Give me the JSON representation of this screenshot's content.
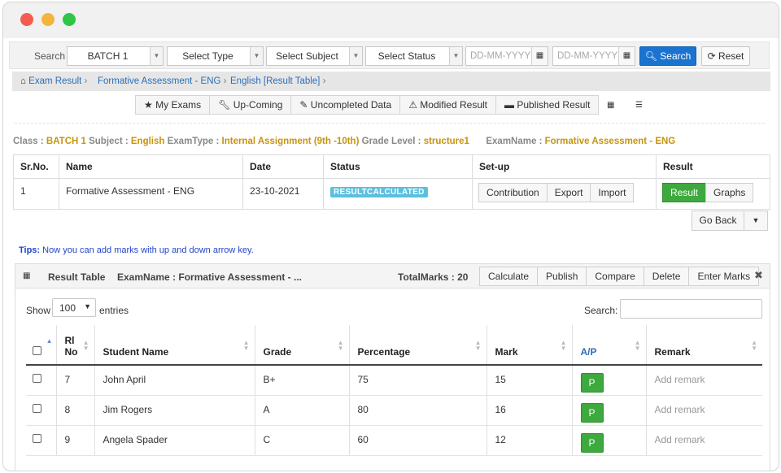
{
  "filter": {
    "search_label": "Search",
    "batch": "BATCH 1",
    "type": "Select Type",
    "subject": "Select Subject",
    "status": "Select Status",
    "date_from_placeholder": "DD-MM-YYYY",
    "date_to_placeholder": "DD-MM-YYYY",
    "search_btn": "Search",
    "reset_btn": "Reset"
  },
  "breadcrumb": [
    "Exam Result",
    "Formative Assessment - ENG",
    "English [Result Table]"
  ],
  "tabs": [
    "My Exams",
    "Up-Coming",
    "Uncompleted Data",
    "Modified Result",
    "Published Result"
  ],
  "info": {
    "class_label": "Class :",
    "class": "BATCH 1",
    "subject_label": "Subject :",
    "subject": "English",
    "examtype_label": "ExamType :",
    "examtype": "Internal Assignment (9th -10th)",
    "grade_label": "Grade Level :",
    "grade": "structure1",
    "examname_label": "ExamName :",
    "examname": "Formative Assessment - ENG"
  },
  "exam_table": {
    "headers": [
      "Sr.No.",
      "Name",
      "Date",
      "Status",
      "Set-up",
      "Result"
    ],
    "row": {
      "srno": "1",
      "name": "Formative Assessment - ENG",
      "date": "23-10-2021",
      "status": "RESULTCALCULATED",
      "setup_buttons": [
        "Contribution",
        "Export",
        "Import"
      ],
      "result_buttons": [
        "Result",
        "Graphs"
      ]
    }
  },
  "goback": "Go Back",
  "tips": {
    "label": "Tips:",
    "text": " Now you can add marks with up and down arrow key."
  },
  "result_panel": {
    "title": "Result Table",
    "examname": "ExamName : Formative Assessment - ...",
    "total": "TotalMarks : 20",
    "buttons": [
      "Calculate",
      "Publish",
      "Compare",
      "Delete",
      "Enter Marks"
    ],
    "close": "✖",
    "show_label": "Show",
    "show_value": "100",
    "entries_label": "entries",
    "search_label": "Search:",
    "columns": [
      "Rl No",
      "Student Name",
      "Grade",
      "Percentage",
      "Mark",
      "A/P",
      "Remark"
    ],
    "rows": [
      {
        "rl": "7",
        "name": "John April",
        "grade": "B+",
        "pct": "75",
        "mark": "15",
        "ap": "P",
        "remark": "Add remark"
      },
      {
        "rl": "8",
        "name": "Jim Rogers",
        "grade": "A",
        "pct": "80",
        "mark": "16",
        "ap": "P",
        "remark": "Add remark"
      },
      {
        "rl": "9",
        "name": "Angela Spader",
        "grade": "C",
        "pct": "60",
        "mark": "12",
        "ap": "P",
        "remark": "Add remark"
      }
    ]
  },
  "icons": {
    "home": "home-icon",
    "star": "star-icon",
    "wrench": "wrench-icon",
    "pencil": "pencil-icon",
    "warning": "warning-icon",
    "folder": "folder-icon",
    "calendar": "calendar-icon",
    "search": "search-icon",
    "refresh": "refresh-icon",
    "grid": "grid-view-icon",
    "list": "list-view-icon"
  },
  "colors": {
    "primary": "#1a73cf",
    "success": "#3ea93e",
    "info_badge": "#5bc0de",
    "highlight": "#c79410",
    "link": "#2a6fb7"
  }
}
